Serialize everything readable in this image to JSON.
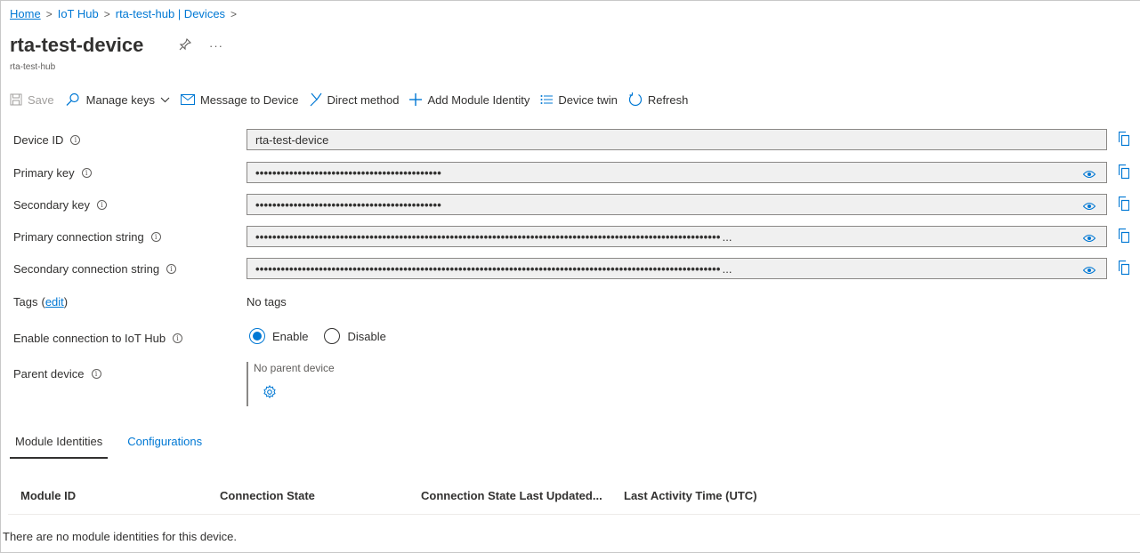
{
  "breadcrumb": {
    "home": "Home",
    "iot_hub": "IoT Hub",
    "devices": "rta-test-hub | Devices"
  },
  "header": {
    "title": "rta-test-device",
    "subtitle": "rta-test-hub",
    "pin_icon": "pin-icon",
    "more_label": "···"
  },
  "toolbar": {
    "save": "Save",
    "manage_keys": "Manage keys",
    "message_to_device": "Message to Device",
    "direct_method": "Direct method",
    "add_module_identity": "Add Module Identity",
    "device_twin": "Device twin",
    "refresh": "Refresh"
  },
  "fields": {
    "device_id": {
      "label": "Device ID",
      "value": "rta-test-device"
    },
    "primary_key": {
      "label": "Primary key",
      "value": "••••••••••••••••••••••••••••••••••••••••••••"
    },
    "secondary_key": {
      "label": "Secondary key",
      "value": "••••••••••••••••••••••••••••••••••••••••••••"
    },
    "primary_conn": {
      "label": "Primary connection string",
      "value": "••••••••••••••••••••••••••••••••••••••••••••••••••••••••••••••••••••••••••••••••••••••••••••••••••••••••••••••",
      "ellipsis": "..."
    },
    "secondary_conn": {
      "label": "Secondary connection string",
      "value": "••••••••••••••••••••••••••••••••••••••••••••••••••••••••••••••••••••••••••••••••••••••••••••••••••••••••••••••",
      "ellipsis": "..."
    }
  },
  "tags": {
    "label": "Tags",
    "edit": "edit",
    "value": "No tags"
  },
  "connection": {
    "label": "Enable connection to IoT Hub",
    "enable": "Enable",
    "disable": "Disable",
    "selected": "Enable"
  },
  "parent": {
    "label": "Parent device",
    "value": "No parent device"
  },
  "tabs": [
    {
      "label": "Module Identities",
      "active": true
    },
    {
      "label": "Configurations",
      "active": false
    }
  ],
  "table": {
    "columns": [
      "Module ID",
      "Connection State",
      "Connection State Last Updated...",
      "Last Activity Time (UTC)"
    ],
    "empty": "There are no module identities for this device."
  },
  "colors": {
    "accent": "#0078d4",
    "text": "#323130",
    "field_bg": "#f0f0f0"
  }
}
